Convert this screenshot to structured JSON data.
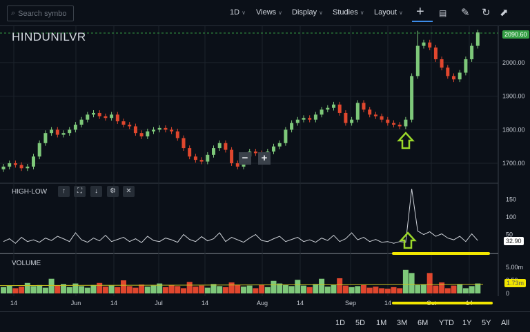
{
  "toolbar": {
    "search_placeholder": "Search symbol",
    "interval": "1D",
    "views": "Views",
    "display": "Display",
    "studies": "Studies",
    "layout": "Layout",
    "icons": [
      "crosshair-icon",
      "comment-icon",
      "pencil-icon",
      "reset-icon",
      "popout-icon"
    ]
  },
  "symbol": "HINDUNILVR",
  "colors": {
    "up": "#7ec87a",
    "down": "#e0472e",
    "accent": "#3d8ce8",
    "last_price": "#35a045",
    "annotation": "#f2e600",
    "arrow": "#9bd82a"
  },
  "price_panel": {
    "y_ticks": [
      "2000.00",
      "1900.00",
      "1800.00",
      "1700.00"
    ],
    "last_price": "2090.60",
    "zoom_out": "−",
    "zoom_in": "+"
  },
  "highlow_panel": {
    "title": "HIGH-LOW",
    "y_ticks": [
      "150",
      "100",
      "50"
    ],
    "last_value": "32.90",
    "buttons": [
      "↑",
      "⛶",
      "↓",
      "⚙",
      "✕"
    ]
  },
  "volume_panel": {
    "title": "VOLUME",
    "y_ticks": [
      "5.00m",
      "2.50m",
      "0"
    ],
    "last_value": "1.73m"
  },
  "x_ticks": [
    "14",
    "Jun",
    "14",
    "Jul",
    "14",
    "Aug",
    "14",
    "Sep",
    "14",
    "Oct",
    "14"
  ],
  "ranges": [
    "1D",
    "5D",
    "1M",
    "3M",
    "6M",
    "YTD",
    "1Y",
    "5Y",
    "All"
  ],
  "chart_data": {
    "type": "candlestick",
    "close": [
      1690,
      1700,
      1695,
      1685,
      1690,
      1720,
      1760,
      1790,
      1800,
      1785,
      1790,
      1800,
      1815,
      1830,
      1845,
      1850,
      1840,
      1835,
      1845,
      1825,
      1815,
      1810,
      1790,
      1780,
      1795,
      1800,
      1805,
      1800,
      1795,
      1775,
      1745,
      1720,
      1710,
      1705,
      1725,
      1745,
      1760,
      1740,
      1700,
      1690,
      1720,
      1735,
      1730,
      1720,
      1735,
      1750,
      1760,
      1800,
      1820,
      1830,
      1835,
      1830,
      1845,
      1860,
      1865,
      1875,
      1850,
      1820,
      1830,
      1880,
      1860,
      1845,
      1840,
      1830,
      1820,
      1815,
      1810,
      1830,
      1960,
      2050,
      2060,
      2045,
      2010,
      1985,
      1960,
      1950,
      1970,
      2010,
      2050,
      2090
    ],
    "high_low": [
      30,
      38,
      25,
      42,
      30,
      35,
      28,
      40,
      33,
      45,
      38,
      30,
      55,
      35,
      28,
      40,
      32,
      48,
      30,
      36,
      42,
      30,
      38,
      27,
      45,
      33,
      30,
      40,
      35,
      28,
      50,
      36,
      30,
      44,
      32,
      38,
      55,
      30,
      42,
      35,
      28,
      40,
      50,
      33,
      30,
      38,
      45,
      30,
      36,
      42,
      30,
      35,
      28,
      40,
      33,
      48,
      30,
      38,
      55,
      35,
      42,
      30,
      36,
      28,
      30,
      25,
      30,
      28,
      180,
      60,
      50,
      58,
      45,
      52,
      40,
      35,
      45,
      30,
      52,
      33
    ],
    "volume_m": [
      1.2,
      1.5,
      1.0,
      1.3,
      2.0,
      1.4,
      1.6,
      1.1,
      2.8,
      1.5,
      1.8,
      1.2,
      1.9,
      1.4,
      1.1,
      1.6,
      2.0,
      1.3,
      1.5,
      1.2,
      2.5,
      1.4,
      1.1,
      1.7,
      1.3,
      1.5,
      1.9,
      1.2,
      1.6,
      1.4,
      1.0,
      2.2,
      1.3,
      1.5,
      1.1,
      1.8,
      1.4,
      1.2,
      2.1,
      1.6,
      1.3,
      1.5,
      1.0,
      1.7,
      1.2,
      2.4,
      1.9,
      1.6,
      1.4,
      2.6,
      1.5,
      1.2,
      1.8,
      2.8,
      1.3,
      1.6,
      2.9,
      1.5,
      1.2,
      1.4,
      1.6,
      1.1,
      1.3,
      1.0,
      0.9,
      1.2,
      1.0,
      4.5,
      3.9,
      1.6,
      1.7,
      3.9,
      1.5,
      2.1,
      1.0,
      1.5,
      1.8,
      1.0,
      1.4,
      1.9,
      2.0,
      5.5,
      1.7,
      1.1
    ],
    "volume_ma_m": 1.73,
    "ylim_price": [
      1650,
      2110
    ],
    "ylim_highlow": [
      0,
      190
    ],
    "ylim_volume": [
      0,
      6
    ]
  }
}
